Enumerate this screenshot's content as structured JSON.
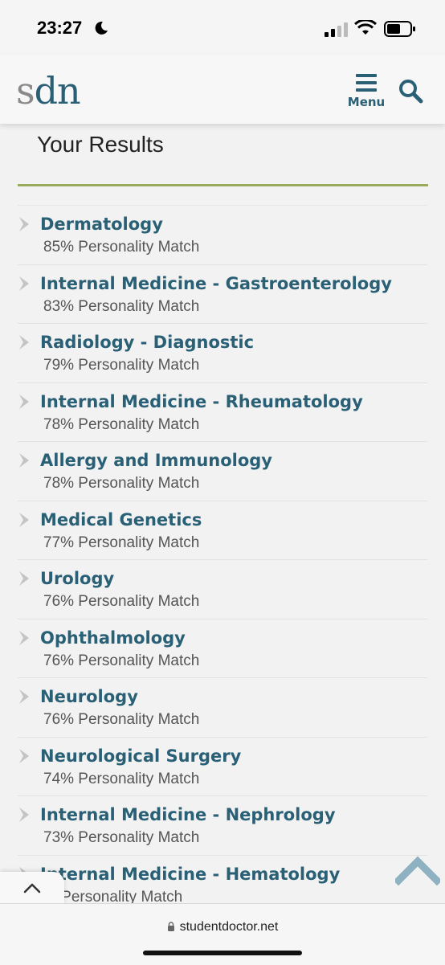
{
  "status": {
    "time": "23:27"
  },
  "header": {
    "logo_s": "s",
    "logo_rest": "dn",
    "menu_label": "Menu"
  },
  "page": {
    "title": "Your Results"
  },
  "results": [
    {
      "name": "Dermatology",
      "match": "85% Personality Match"
    },
    {
      "name": "Internal Medicine - Gastroenterology",
      "match": "83% Personality Match"
    },
    {
      "name": "Radiology - Diagnostic",
      "match": "79% Personality Match"
    },
    {
      "name": "Internal Medicine - Rheumatology",
      "match": "78% Personality Match"
    },
    {
      "name": "Allergy and Immunology",
      "match": "78% Personality Match"
    },
    {
      "name": "Medical Genetics",
      "match": "77% Personality Match"
    },
    {
      "name": "Urology",
      "match": "76% Personality Match"
    },
    {
      "name": "Ophthalmology",
      "match": "76% Personality Match"
    },
    {
      "name": "Neurology",
      "match": "76% Personality Match"
    },
    {
      "name": "Neurological Surgery",
      "match": "74% Personality Match"
    },
    {
      "name": "Internal Medicine - Nephrology",
      "match": "73% Personality Match"
    },
    {
      "name": "Internal Medicine - Hematology",
      "match": "% Personality Match"
    }
  ],
  "browser": {
    "url": "studentdoctor.net"
  },
  "colors": {
    "brand": "#2a6076",
    "accent_rule": "#9aab5e"
  }
}
